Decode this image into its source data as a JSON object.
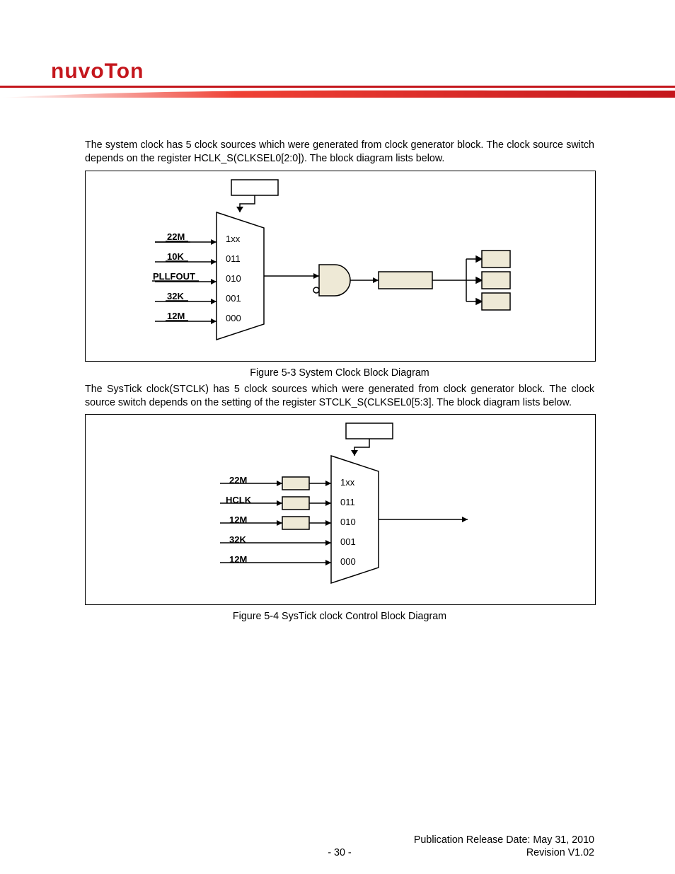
{
  "logo_text": "nuvoTon",
  "para1": "The system clock has 5 clock sources which were generated from clock generator block. The clock source switch depends on the register HCLK_S(CLKSEL0[2:0]). The block diagram lists below.",
  "fig1": {
    "caption": "Figure 5-3 System Clock Block Diagram",
    "inputs": [
      "22M",
      "10K",
      "PLLFOUT",
      "32K",
      "12M"
    ],
    "sel": [
      "1xx",
      "011",
      "010",
      "001",
      "000"
    ]
  },
  "para2": "The SysTick clock(STCLK) has 5 clock sources which were generated from clock generator block. The clock source switch depends on the setting of the register STCLK_S(CLKSEL0[5:3]. The block diagram lists below.",
  "fig2": {
    "caption": "Figure 5-4 SysTick clock Control Block Diagram",
    "inputs": [
      "22M",
      "HCLK",
      "12M",
      "32K",
      "12M"
    ],
    "sel": [
      "1xx",
      "011",
      "010",
      "001",
      "000"
    ]
  },
  "footer": {
    "page": "- 30 -",
    "pubdate": "Publication Release Date: May 31, 2010",
    "rev": "Revision V1.02"
  }
}
